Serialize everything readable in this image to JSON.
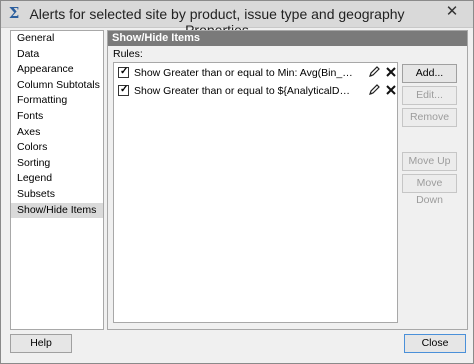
{
  "window": {
    "title": "Alerts for selected site by product, issue type and geography Properties",
    "close_glyph": "✕",
    "app_icon": "Σ"
  },
  "sidebar": {
    "items": [
      {
        "label": "General"
      },
      {
        "label": "Data"
      },
      {
        "label": "Appearance"
      },
      {
        "label": "Column Subtotals"
      },
      {
        "label": "Formatting"
      },
      {
        "label": "Fonts"
      },
      {
        "label": "Axes"
      },
      {
        "label": "Colors"
      },
      {
        "label": "Sorting"
      },
      {
        "label": "Legend"
      },
      {
        "label": "Subsets"
      },
      {
        "label": "Show/Hide Items"
      }
    ],
    "selected": "Show/Hide Items"
  },
  "panel": {
    "header": "Show/Hide Items",
    "rules_label": "Rules:",
    "rules": [
      {
        "checked": true,
        "text": "Show Greater than or equal to Min: Avg(Bin_Calc)"
      },
      {
        "checked": true,
        "text": "Show Greater than or equal to ${AnalyticalDashboardIncre..."
      }
    ],
    "buttons": {
      "add": "Add...",
      "edit": "Edit...",
      "remove": "Remove",
      "move_up": "Move Up",
      "move_down": "Move Down"
    }
  },
  "footer": {
    "help": "Help",
    "close": "Close"
  }
}
